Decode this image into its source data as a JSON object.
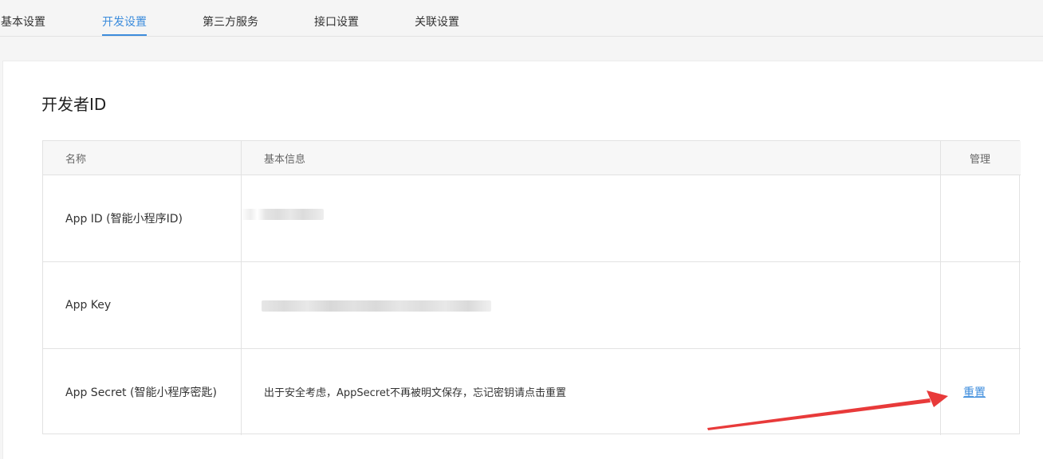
{
  "tabs": [
    {
      "label": "基本设置",
      "active": false
    },
    {
      "label": "开发设置",
      "active": true
    },
    {
      "label": "第三方服务",
      "active": false
    },
    {
      "label": "接口设置",
      "active": false
    },
    {
      "label": "关联设置",
      "active": false
    }
  ],
  "section": {
    "title": "开发者ID"
  },
  "table": {
    "headers": [
      "名称",
      "基本信息",
      "管理"
    ],
    "rows": [
      {
        "name": "App ID (智能小程序ID)",
        "info": "",
        "action": ""
      },
      {
        "name": "App Key",
        "info": "",
        "action": ""
      },
      {
        "name": "App Secret (智能小程序密匙)",
        "info": "出于安全考虑，AppSecret不再被明文保存，忘记密钥请点击重置",
        "action": "重置"
      }
    ]
  },
  "colors": {
    "accent": "#3c8cdc",
    "annotation_arrow": "#e83a3a"
  }
}
